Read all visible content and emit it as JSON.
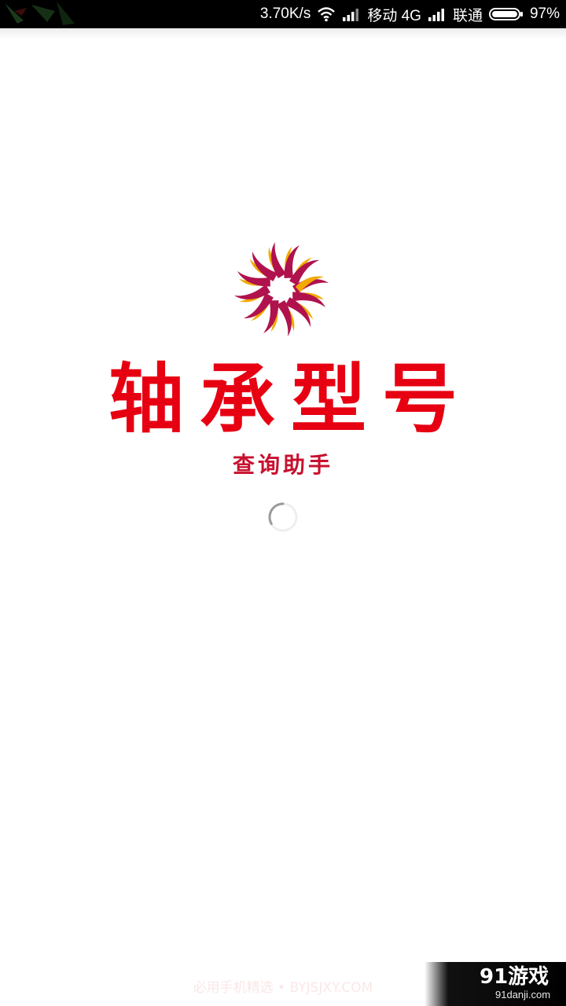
{
  "status_bar": {
    "network_speed": "3.70K/s",
    "carrier1": "移动 4G",
    "carrier2": "联通",
    "battery": "97%",
    "icons": [
      "wifi-icon",
      "signal-icon",
      "signal-icon",
      "battery-icon"
    ]
  },
  "splash": {
    "title": "轴承型号",
    "subtitle": "查询助手",
    "logo_colors": [
      "#b0124d",
      "#f2a900"
    ],
    "title_color": "#e60012"
  },
  "footer": {
    "text": "必用手机精选 • BYJSJXY.COM"
  },
  "watermark": {
    "logo": "91游戏",
    "url": "91danji.com"
  }
}
